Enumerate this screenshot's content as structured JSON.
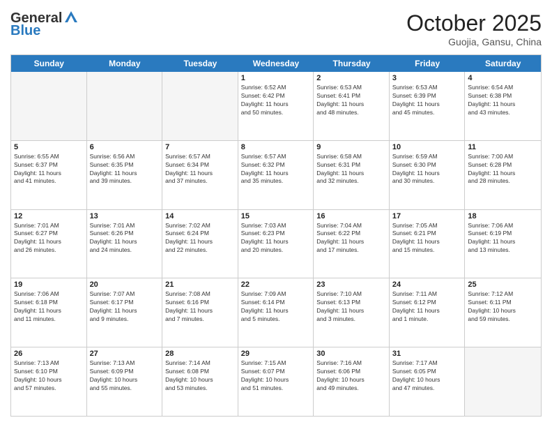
{
  "logo": {
    "general": "General",
    "blue": "Blue"
  },
  "header": {
    "month": "October 2025",
    "location": "Guojia, Gansu, China"
  },
  "weekdays": [
    "Sunday",
    "Monday",
    "Tuesday",
    "Wednesday",
    "Thursday",
    "Friday",
    "Saturday"
  ],
  "rows": [
    [
      {
        "day": "",
        "info": ""
      },
      {
        "day": "",
        "info": ""
      },
      {
        "day": "",
        "info": ""
      },
      {
        "day": "1",
        "info": "Sunrise: 6:52 AM\nSunset: 6:42 PM\nDaylight: 11 hours\nand 50 minutes."
      },
      {
        "day": "2",
        "info": "Sunrise: 6:53 AM\nSunset: 6:41 PM\nDaylight: 11 hours\nand 48 minutes."
      },
      {
        "day": "3",
        "info": "Sunrise: 6:53 AM\nSunset: 6:39 PM\nDaylight: 11 hours\nand 45 minutes."
      },
      {
        "day": "4",
        "info": "Sunrise: 6:54 AM\nSunset: 6:38 PM\nDaylight: 11 hours\nand 43 minutes."
      }
    ],
    [
      {
        "day": "5",
        "info": "Sunrise: 6:55 AM\nSunset: 6:37 PM\nDaylight: 11 hours\nand 41 minutes."
      },
      {
        "day": "6",
        "info": "Sunrise: 6:56 AM\nSunset: 6:35 PM\nDaylight: 11 hours\nand 39 minutes."
      },
      {
        "day": "7",
        "info": "Sunrise: 6:57 AM\nSunset: 6:34 PM\nDaylight: 11 hours\nand 37 minutes."
      },
      {
        "day": "8",
        "info": "Sunrise: 6:57 AM\nSunset: 6:32 PM\nDaylight: 11 hours\nand 35 minutes."
      },
      {
        "day": "9",
        "info": "Sunrise: 6:58 AM\nSunset: 6:31 PM\nDaylight: 11 hours\nand 32 minutes."
      },
      {
        "day": "10",
        "info": "Sunrise: 6:59 AM\nSunset: 6:30 PM\nDaylight: 11 hours\nand 30 minutes."
      },
      {
        "day": "11",
        "info": "Sunrise: 7:00 AM\nSunset: 6:28 PM\nDaylight: 11 hours\nand 28 minutes."
      }
    ],
    [
      {
        "day": "12",
        "info": "Sunrise: 7:01 AM\nSunset: 6:27 PM\nDaylight: 11 hours\nand 26 minutes."
      },
      {
        "day": "13",
        "info": "Sunrise: 7:01 AM\nSunset: 6:26 PM\nDaylight: 11 hours\nand 24 minutes."
      },
      {
        "day": "14",
        "info": "Sunrise: 7:02 AM\nSunset: 6:24 PM\nDaylight: 11 hours\nand 22 minutes."
      },
      {
        "day": "15",
        "info": "Sunrise: 7:03 AM\nSunset: 6:23 PM\nDaylight: 11 hours\nand 20 minutes."
      },
      {
        "day": "16",
        "info": "Sunrise: 7:04 AM\nSunset: 6:22 PM\nDaylight: 11 hours\nand 17 minutes."
      },
      {
        "day": "17",
        "info": "Sunrise: 7:05 AM\nSunset: 6:21 PM\nDaylight: 11 hours\nand 15 minutes."
      },
      {
        "day": "18",
        "info": "Sunrise: 7:06 AM\nSunset: 6:19 PM\nDaylight: 11 hours\nand 13 minutes."
      }
    ],
    [
      {
        "day": "19",
        "info": "Sunrise: 7:06 AM\nSunset: 6:18 PM\nDaylight: 11 hours\nand 11 minutes."
      },
      {
        "day": "20",
        "info": "Sunrise: 7:07 AM\nSunset: 6:17 PM\nDaylight: 11 hours\nand 9 minutes."
      },
      {
        "day": "21",
        "info": "Sunrise: 7:08 AM\nSunset: 6:16 PM\nDaylight: 11 hours\nand 7 minutes."
      },
      {
        "day": "22",
        "info": "Sunrise: 7:09 AM\nSunset: 6:14 PM\nDaylight: 11 hours\nand 5 minutes."
      },
      {
        "day": "23",
        "info": "Sunrise: 7:10 AM\nSunset: 6:13 PM\nDaylight: 11 hours\nand 3 minutes."
      },
      {
        "day": "24",
        "info": "Sunrise: 7:11 AM\nSunset: 6:12 PM\nDaylight: 11 hours\nand 1 minute."
      },
      {
        "day": "25",
        "info": "Sunrise: 7:12 AM\nSunset: 6:11 PM\nDaylight: 10 hours\nand 59 minutes."
      }
    ],
    [
      {
        "day": "26",
        "info": "Sunrise: 7:13 AM\nSunset: 6:10 PM\nDaylight: 10 hours\nand 57 minutes."
      },
      {
        "day": "27",
        "info": "Sunrise: 7:13 AM\nSunset: 6:09 PM\nDaylight: 10 hours\nand 55 minutes."
      },
      {
        "day": "28",
        "info": "Sunrise: 7:14 AM\nSunset: 6:08 PM\nDaylight: 10 hours\nand 53 minutes."
      },
      {
        "day": "29",
        "info": "Sunrise: 7:15 AM\nSunset: 6:07 PM\nDaylight: 10 hours\nand 51 minutes."
      },
      {
        "day": "30",
        "info": "Sunrise: 7:16 AM\nSunset: 6:06 PM\nDaylight: 10 hours\nand 49 minutes."
      },
      {
        "day": "31",
        "info": "Sunrise: 7:17 AM\nSunset: 6:05 PM\nDaylight: 10 hours\nand 47 minutes."
      },
      {
        "day": "",
        "info": ""
      }
    ]
  ]
}
